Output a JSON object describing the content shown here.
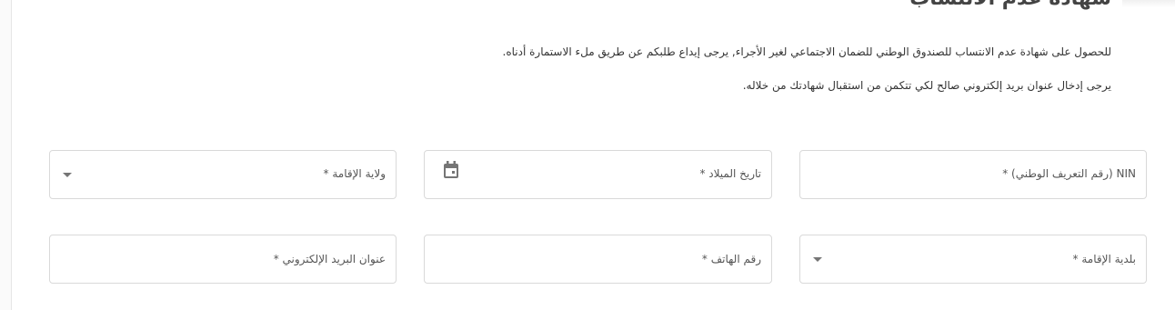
{
  "page": {
    "title": "شهادة عدم الانتساب"
  },
  "intro": {
    "line1": "للحصول على شهادة عدم الانتساب للصندوق الوطني للضمان الاجتماعي لغير الأجراء, يرجى إيداع طلبكم عن طريق ملء الاستمارة أدناه.",
    "line2": "يرجى إدخال عنوان بريد إلكتروني صالح لكي تتكمن من استقبال شهادتك من خلاله."
  },
  "form": {
    "nin_label": "NIN (رقم التعريف الوطني) *",
    "birthdate_label": "تاريخ الميلاد *",
    "wilaya_label": "ولاية الإقامة *",
    "commune_label": "بلدية الإقامة *",
    "phone_label": "رقم الهاتف *",
    "email_label": "عنوان البريد الإلكتروني *"
  },
  "icons": {
    "calendar": "calendar-icon",
    "dropdown": "chevron-down-icon"
  }
}
